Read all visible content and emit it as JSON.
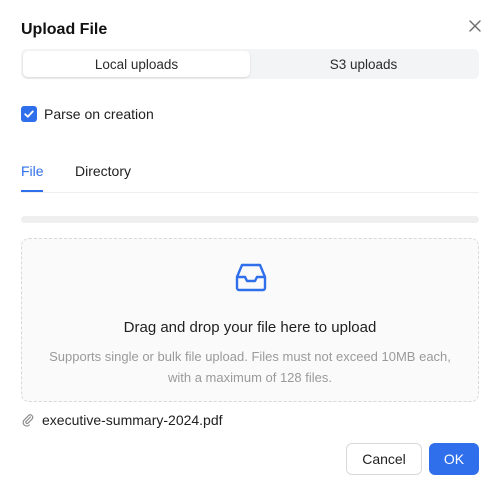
{
  "dialog": {
    "title": "Upload File"
  },
  "source_tabs": {
    "items": [
      {
        "label": "Local uploads",
        "active": true
      },
      {
        "label": "S3 uploads",
        "active": false
      }
    ]
  },
  "parse_option": {
    "label": "Parse on creation",
    "checked": true
  },
  "upload_tabs": {
    "items": [
      {
        "label": "File",
        "active": true
      },
      {
        "label": "Directory",
        "active": false
      }
    ]
  },
  "progress": {
    "value": 0
  },
  "dropzone": {
    "icon": "inbox-icon",
    "title": "Drag and drop your file here to upload",
    "hint": "Supports single or bulk file upload. Files must not exceed 10MB each, with a maximum of 128 files."
  },
  "file_list": [
    {
      "icon": "paperclip-icon",
      "name": "executive-summary-2024.pdf"
    }
  ],
  "footer": {
    "cancel_label": "Cancel",
    "ok_label": "OK"
  },
  "colors": {
    "accent": "#2f6fec",
    "muted_text": "#9a9a9a",
    "border": "#d9d9d9"
  }
}
